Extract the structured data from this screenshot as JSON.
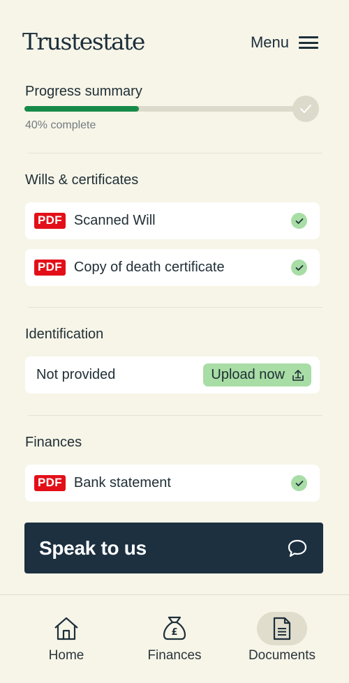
{
  "header": {
    "logo": "Trustestate",
    "menu_label": "Menu",
    "menu_icon": "hamburger-icon"
  },
  "progress": {
    "title": "Progress summary",
    "percent": 40,
    "caption": "40% complete",
    "end_icon": "check-icon"
  },
  "sections": {
    "wills": {
      "title": "Wills & certificates",
      "items": [
        {
          "badge": "PDF",
          "label": "Scanned Will",
          "status": "complete"
        },
        {
          "badge": "PDF",
          "label": "Copy of death certificate",
          "status": "complete"
        }
      ]
    },
    "identification": {
      "title": "Identification",
      "status_text": "Not provided",
      "upload_label": "Upload now",
      "upload_icon": "upload-icon"
    },
    "finances": {
      "title": "Finances",
      "items": [
        {
          "badge": "PDF",
          "label": "Bank statement",
          "status": "complete"
        }
      ]
    }
  },
  "speak": {
    "label": "Speak to us",
    "icon": "chat-bubble-icon"
  },
  "bottom_nav": {
    "items": [
      {
        "label": "Home",
        "icon": "home-icon",
        "active": false
      },
      {
        "label": "Finances",
        "icon": "money-bag-icon",
        "active": false
      },
      {
        "label": "Documents",
        "icon": "document-icon",
        "active": true
      }
    ]
  },
  "colors": {
    "background": "#f7f5e8",
    "accent_green": "#178a4a",
    "check_green": "#a8dda5",
    "pdf_red": "#e30f18",
    "navy": "#1c3040"
  }
}
